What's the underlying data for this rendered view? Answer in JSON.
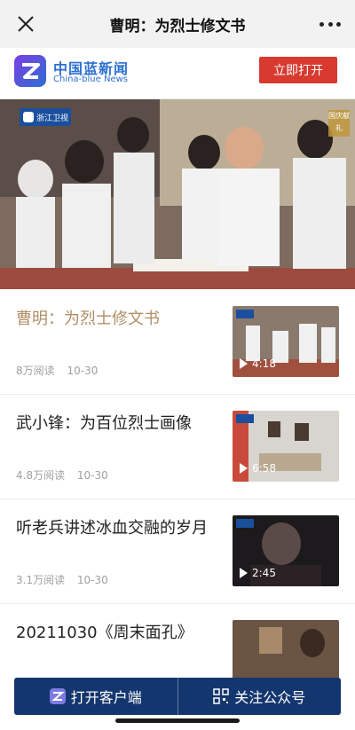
{
  "topbar": {
    "title": "曹明：为烈士修文书"
  },
  "brand": {
    "name_cn": "中国蓝新闻",
    "name_en": "China-blue News",
    "open_label": "立即打开"
  },
  "hero": {
    "badge": "浙江卫视",
    "mark": "国庆献礼"
  },
  "articles": [
    {
      "title": "曹明：为烈士修文书",
      "views": "8万阅读",
      "date": "10-30",
      "duration": "4:18"
    },
    {
      "title": "武小锋：为百位烈士画像",
      "views": "4.8万阅读",
      "date": "10-30",
      "duration": "6:58"
    },
    {
      "title": "听老兵讲述冰血交融的岁月",
      "views": "3.1万阅读",
      "date": "10-30",
      "duration": "2:45"
    },
    {
      "title": "20211030《周末面孔》",
      "views": "",
      "date": "",
      "duration": ""
    }
  ],
  "bottom": {
    "open_client": "打开客户端",
    "follow": "关注公众号"
  },
  "colors": {
    "accent_red": "#d83a2f",
    "brand_blue": "#2d6fd1",
    "bar_navy": "#14366e",
    "active_title": "#b08e66"
  }
}
